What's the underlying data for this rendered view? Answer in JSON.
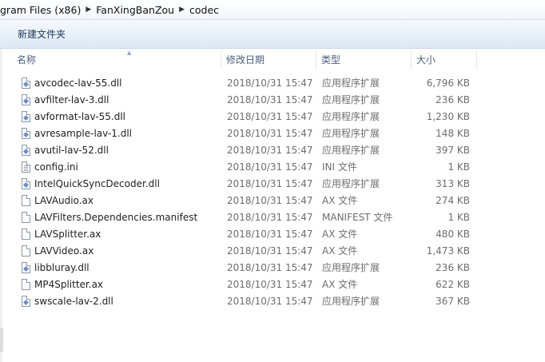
{
  "breadcrumb": {
    "items": [
      "gram Files (x86)",
      "FanXingBanZou",
      "codec"
    ]
  },
  "toolbar": {
    "new_folder_label": "新建文件夹"
  },
  "columns": {
    "name": "名称",
    "date": "修改日期",
    "type": "类型",
    "size": "大小"
  },
  "files": [
    {
      "name": "avcodec-lav-55.dll",
      "date": "2018/10/31 15:47",
      "type": "应用程序扩展",
      "size": "6,796 KB",
      "icon": "dll"
    },
    {
      "name": "avfilter-lav-3.dll",
      "date": "2018/10/31 15:47",
      "type": "应用程序扩展",
      "size": "236 KB",
      "icon": "dll"
    },
    {
      "name": "avformat-lav-55.dll",
      "date": "2018/10/31 15:47",
      "type": "应用程序扩展",
      "size": "1,230 KB",
      "icon": "dll"
    },
    {
      "name": "avresample-lav-1.dll",
      "date": "2018/10/31 15:47",
      "type": "应用程序扩展",
      "size": "148 KB",
      "icon": "dll"
    },
    {
      "name": "avutil-lav-52.dll",
      "date": "2018/10/31 15:47",
      "type": "应用程序扩展",
      "size": "397 KB",
      "icon": "dll"
    },
    {
      "name": "config.ini",
      "date": "2018/10/31 15:47",
      "type": "INI 文件",
      "size": "1 KB",
      "icon": "ini"
    },
    {
      "name": "IntelQuickSyncDecoder.dll",
      "date": "2018/10/31 15:47",
      "type": "应用程序扩展",
      "size": "313 KB",
      "icon": "dll"
    },
    {
      "name": "LAVAudio.ax",
      "date": "2018/10/31 15:47",
      "type": "AX 文件",
      "size": "274 KB",
      "icon": "file"
    },
    {
      "name": "LAVFilters.Dependencies.manifest",
      "date": "2018/10/31 15:47",
      "type": "MANIFEST 文件",
      "size": "1 KB",
      "icon": "file"
    },
    {
      "name": "LAVSplitter.ax",
      "date": "2018/10/31 15:47",
      "type": "AX 文件",
      "size": "480 KB",
      "icon": "file"
    },
    {
      "name": "LAVVideo.ax",
      "date": "2018/10/31 15:47",
      "type": "AX 文件",
      "size": "1,473 KB",
      "icon": "file"
    },
    {
      "name": "libbluray.dll",
      "date": "2018/10/31 15:47",
      "type": "应用程序扩展",
      "size": "236 KB",
      "icon": "dll"
    },
    {
      "name": "MP4Splitter.ax",
      "date": "2018/10/31 15:47",
      "type": "AX 文件",
      "size": "622 KB",
      "icon": "file"
    },
    {
      "name": "swscale-lav-2.dll",
      "date": "2018/10/31 15:47",
      "type": "应用程序扩展",
      "size": "367 KB",
      "icon": "dll"
    }
  ]
}
